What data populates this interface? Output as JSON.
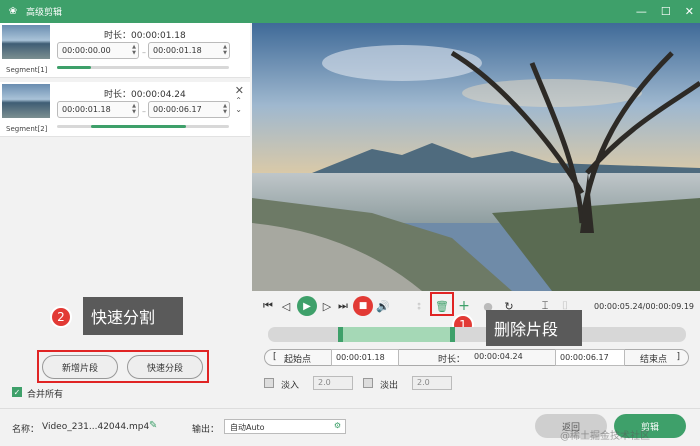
{
  "window": {
    "title": "高级剪辑",
    "min": "—",
    "max": "☐",
    "close": "✕"
  },
  "segments": [
    {
      "label": "Segment[1]",
      "duration_label": "时长：00:00:01.18",
      "start": "00:00:00.00",
      "end": "00:00:01.18",
      "progress": 0.2
    },
    {
      "label": "Segment[2]",
      "duration_label": "时长：00:00:04.24",
      "start": "00:00:01.18",
      "end": "00:00:06.17",
      "progress": 0.75
    }
  ],
  "buttons": {
    "add_segment": "新增片段",
    "quick_split": "快速分段",
    "merge_all": "合并所有"
  },
  "callouts": [
    {
      "num": "2",
      "text": "快速分割"
    },
    {
      "num": "1",
      "text": "删除片段"
    }
  ],
  "player": {
    "time": "00:00:05.24/00:00:09.19"
  },
  "trim": {
    "start_btn": "起始点",
    "start_value": "00:00:01.18",
    "duration_label": "时长：",
    "duration_value": "00:00:04.24",
    "end_value": "00:00:06.17",
    "end_btn": "结束点"
  },
  "fade": {
    "fade_in_label": "淡入",
    "fade_in_value": "2.0",
    "fade_out_label": "淡出",
    "fade_out_value": "2.0"
  },
  "footer": {
    "name_label": "名称：",
    "filename": "Video_231...42044.mp4",
    "output_label": "输出：",
    "output_value": "自动Auto",
    "back": "返回",
    "cut": "剪辑",
    "watermark": "@稀土掘金技术社区"
  }
}
